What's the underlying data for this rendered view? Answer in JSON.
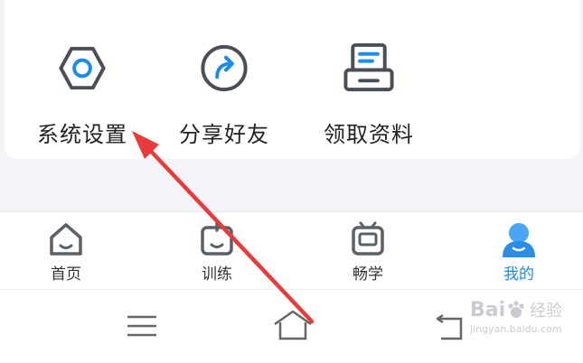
{
  "tools": [
    {
      "label": "系统设置",
      "icon": "hexagon-settings-icon"
    },
    {
      "label": "分享好友",
      "icon": "share-arrow-icon"
    },
    {
      "label": "领取资料",
      "icon": "printer-materials-icon"
    }
  ],
  "tabs": [
    {
      "label": "首页",
      "icon": "home-icon",
      "active": false
    },
    {
      "label": "训练",
      "icon": "training-icon",
      "active": false
    },
    {
      "label": "畅学",
      "icon": "learn-tv-icon",
      "active": false
    },
    {
      "label": "我的",
      "icon": "profile-icon",
      "active": true
    }
  ],
  "system_nav": {
    "menu_icon": "menu-lines-icon",
    "home_icon": "system-home-icon",
    "back_icon": "back-icon"
  },
  "watermark": {
    "logo": "Bai",
    "sub": "经验",
    "url": "jingyan.baidu.com"
  },
  "colors": {
    "accent": "#1a8cf0",
    "annotation_arrow": "#ea3a3a",
    "icon_gray": "#5a6068"
  }
}
